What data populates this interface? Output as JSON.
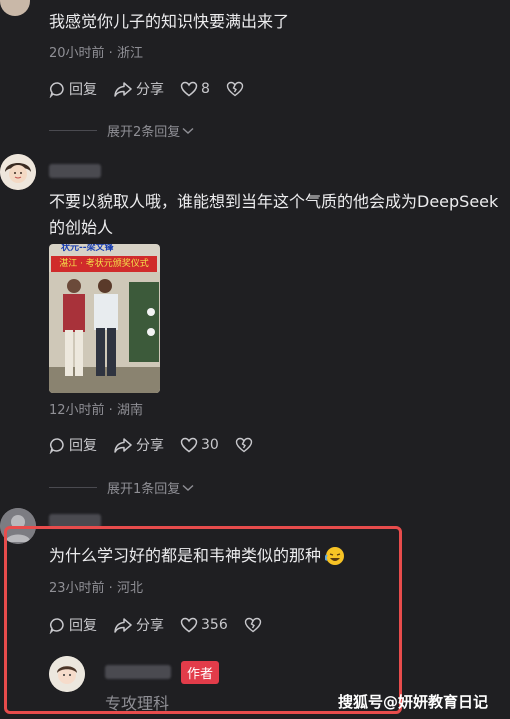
{
  "comments": [
    {
      "text": "我感觉你儿子的知识快要满出来了",
      "meta": "20小时前 · 浙江",
      "reply_label": "回复",
      "share_label": "分享",
      "likes": "8",
      "expand_label": "展开2条回复"
    },
    {
      "text": "不要以貌取人哦，谁能想到当年这个气质的他会成为DeepSeek的创始人",
      "photo_caption": "状元--梁文锋",
      "photo_banner": "湛江 · 考状元颁奖仪式",
      "meta": "12小时前 · 湖南",
      "reply_label": "回复",
      "share_label": "分享",
      "likes": "30",
      "expand_label": "展开1条回复"
    },
    {
      "text": "为什么学习好的都是和韦神类似的那种",
      "meta": "23小时前 · 河北",
      "reply_label": "回复",
      "share_label": "分享",
      "likes": "356",
      "reply_preview": {
        "author_tag": "作者",
        "text": "专攻理科"
      }
    }
  ],
  "watermark": "搜狐号@妍妍教育日记",
  "colors": {
    "highlight": "#e74c4c",
    "author_tag": "#e23c4a",
    "background": "#1f1f22"
  }
}
